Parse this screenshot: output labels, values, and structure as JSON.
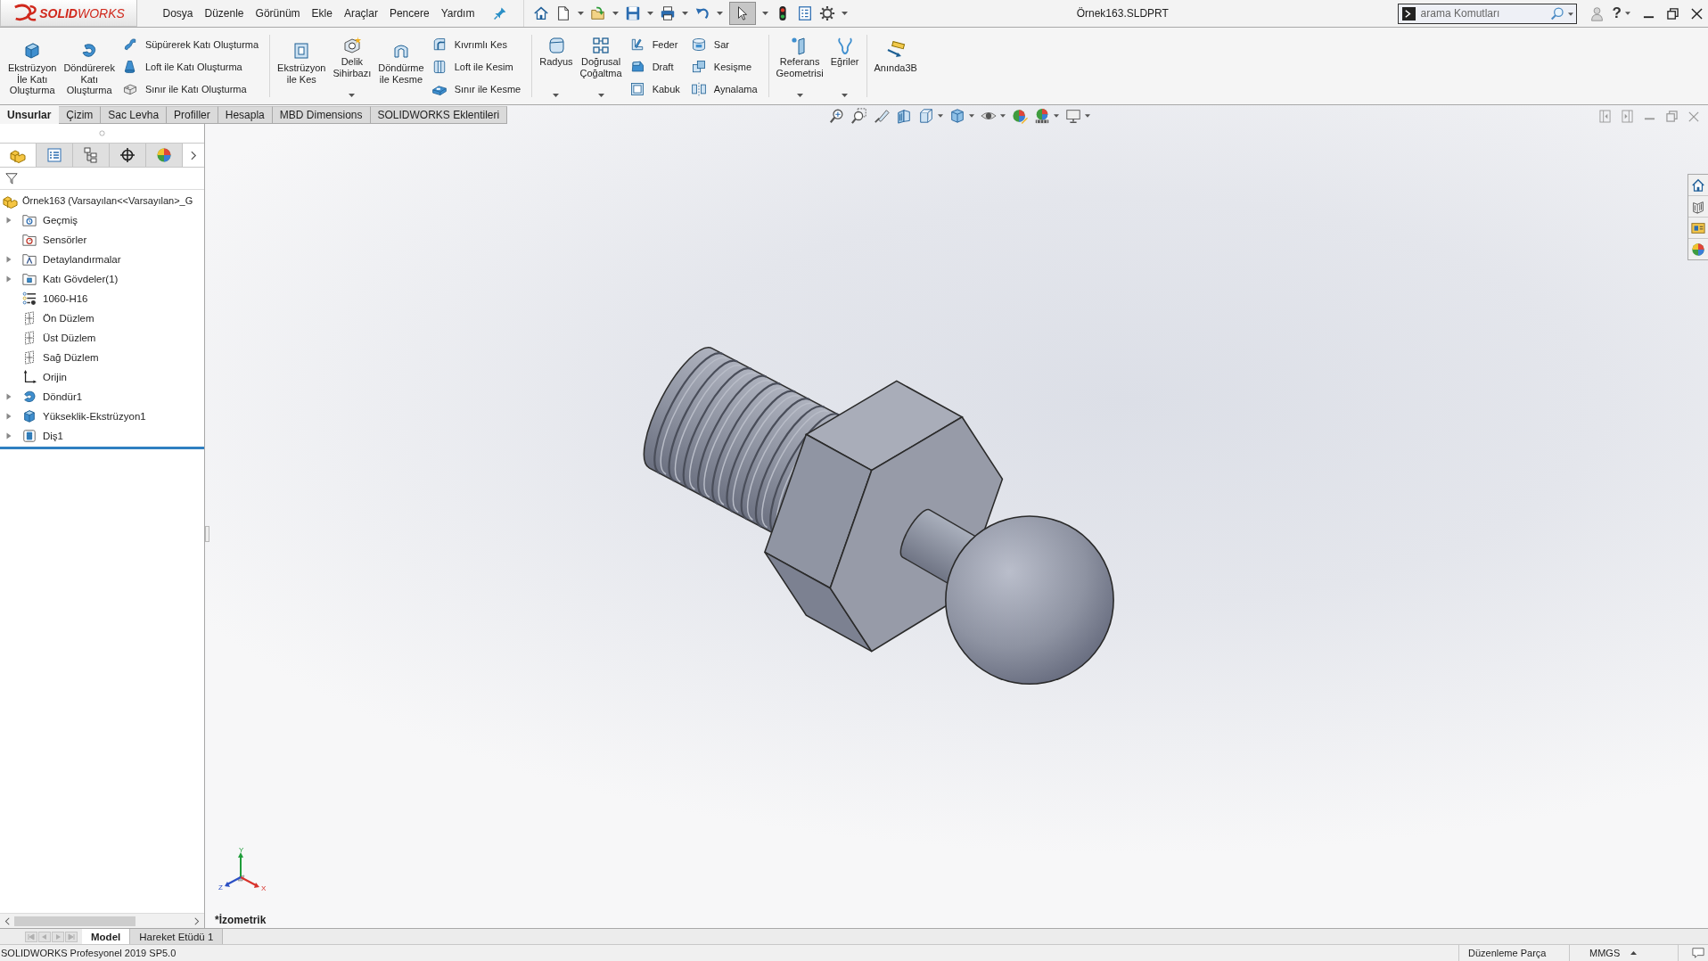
{
  "title_bar": {
    "logo": "**SOLID**WORKS",
    "menu": [
      "Dosya",
      "Düzenle",
      "Görünüm",
      "Ekle",
      "Araçlar",
      "Pencere",
      "Yardım"
    ],
    "select_tool_pressed": true,
    "document_title": "Örnek163.SLDPRT",
    "search": {
      "placeholder": "arama Komutları"
    },
    "help": "?"
  },
  "ribbon": {
    "groups": [
      {
        "items": [
          {
            "kind": "large",
            "label": "Ekstrüzyon\nİle Katı\nOluşturma",
            "dropdown": false
          },
          {
            "kind": "large",
            "label": "Döndürerek\nKatı\nOluşturma",
            "dropdown": false
          },
          {
            "kind": "stack",
            "labels": [
              "Süpürerek Katı Oluşturma",
              "Loft ile Katı Oluşturma",
              "Sınır ile Katı Oluşturma"
            ]
          }
        ]
      },
      {
        "items": [
          {
            "kind": "large",
            "label": "Ekstrüzyon\nile Kes",
            "dropdown": false
          },
          {
            "kind": "large",
            "label": "Delik\nSihirbazı",
            "dropdown": true
          },
          {
            "kind": "large",
            "label": "Döndürme\nile Kesme",
            "dropdown": false
          },
          {
            "kind": "stack",
            "labels": [
              "Kıvrımlı Kes",
              "Loft ile Kesim",
              "Sınır ile Kesme"
            ]
          }
        ]
      },
      {
        "items": [
          {
            "kind": "large",
            "label": "Radyus",
            "dropdown": true
          },
          {
            "kind": "large",
            "label": "Doğrusal\nÇoğaltma",
            "dropdown": true
          },
          {
            "kind": "stack",
            "labels": [
              "Feder",
              "Draft",
              "Kabuk"
            ]
          },
          {
            "kind": "stack",
            "labels": [
              "Sar",
              "Kesişme",
              "Aynalama"
            ]
          }
        ]
      },
      {
        "items": [
          {
            "kind": "large",
            "label": "Referans\nGeometrisi",
            "dropdown": true
          },
          {
            "kind": "large",
            "label": "Eğriler",
            "dropdown": true
          }
        ]
      },
      {
        "items": [
          {
            "kind": "large",
            "label": "Anında3B",
            "dropdown": false
          }
        ]
      }
    ]
  },
  "tabs": [
    {
      "label": "Unsurlar",
      "selected": true
    },
    {
      "label": "Çizim",
      "selected": false
    },
    {
      "label": "Sac Levha",
      "selected": false
    },
    {
      "label": "Profiller",
      "selected": false
    },
    {
      "label": "Hesapla",
      "selected": false
    },
    {
      "label": "MBD Dimensions",
      "selected": false
    },
    {
      "label": "SOLIDWORKS Eklentileri",
      "selected": false
    }
  ],
  "feature_manager": {
    "tabs": [
      {
        "selected": true
      },
      {
        "selected": false
      },
      {
        "selected": false
      },
      {
        "selected": false
      },
      {
        "selected": false
      }
    ],
    "tree": {
      "label": "Örnek163 (Varsayılan<<Varsayılan>_G",
      "children": [
        {
          "label": "Geçmiş",
          "kind": "history",
          "expandable": true
        },
        {
          "label": "Sensörler",
          "kind": "sensors",
          "expandable": false
        },
        {
          "label": "Detaylandırmalar",
          "kind": "annotations",
          "expandable": true
        },
        {
          "label": "Katı Gövdeler(1)",
          "kind": "bodies",
          "expandable": true
        },
        {
          "label": "1060-H16",
          "kind": "material",
          "expandable": false
        },
        {
          "label": "Ön Düzlem",
          "kind": "plane",
          "expandable": false
        },
        {
          "label": "Üst Düzlem",
          "kind": "plane",
          "expandable": false
        },
        {
          "label": "Sağ Düzlem",
          "kind": "plane",
          "expandable": false
        },
        {
          "label": "Orijin",
          "kind": "origin",
          "expandable": false
        },
        {
          "label": "Döndür1",
          "kind": "revolve",
          "expandable": true
        },
        {
          "label": "Yükseklik-Ekstrüzyon1",
          "kind": "extrude",
          "expandable": true
        },
        {
          "label": "Diş1",
          "kind": "thread",
          "expandable": true
        }
      ]
    }
  },
  "graphics": {
    "view_name": "*İzometrik",
    "axes": [
      "X",
      "Y",
      "Z"
    ]
  },
  "model_tabs": [
    {
      "label": "Model",
      "selected": true
    },
    {
      "label": "Hareket Etüdü 1",
      "selected": false
    }
  ],
  "status_bar": {
    "product": "SOLIDWORKS Profesyonel 2019 SP5.0",
    "mode": "Düzenleme Parça",
    "units": "MMGS"
  }
}
